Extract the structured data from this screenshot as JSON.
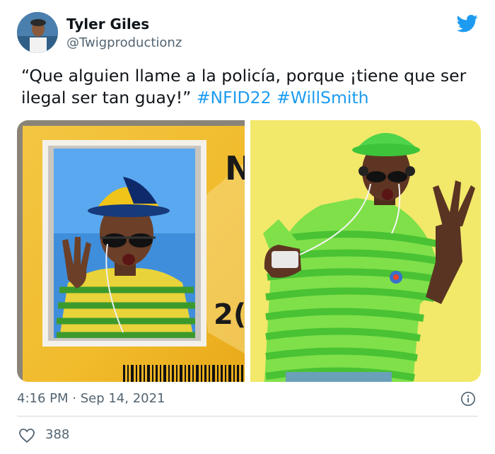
{
  "author": {
    "name": "Tyler Giles",
    "handle": "@Twigproductionz"
  },
  "tweet": {
    "text_plain": "“Que alguien llame a la policía, porque ¡tiene que ser ilegal ser tan guay!”",
    "hashtag_1": "#NFID22",
    "hashtag_2": "#WillSmith"
  },
  "photos": {
    "id_card_letters_top": "N",
    "id_card_letters_bottom": "2("
  },
  "meta": {
    "timestamp": "4:16 PM · Sep 14, 2021"
  },
  "engagement": {
    "like_count": "388"
  },
  "colors": {
    "link": "#1d9bf0",
    "text": "#0f1419",
    "muted": "#536471",
    "twitter_blue": "#1d9bf0"
  },
  "icons": {
    "brand": "twitter-bird-icon",
    "info": "info-icon",
    "like": "heart-icon"
  }
}
